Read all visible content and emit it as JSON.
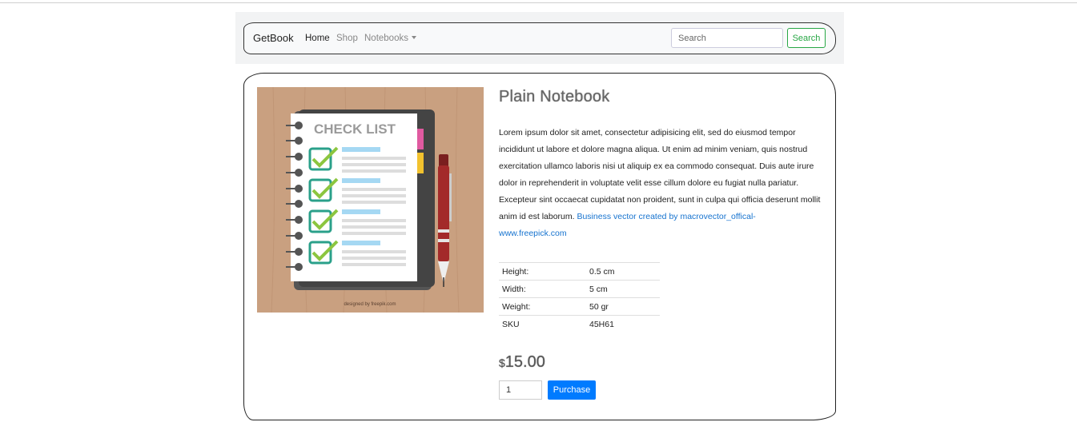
{
  "navbar": {
    "brand": "GetBook",
    "links": [
      {
        "label": "Home"
      },
      {
        "label": "Shop"
      },
      {
        "label": "Notebooks"
      }
    ],
    "search_placeholder": "Search",
    "search_button": "Search"
  },
  "product": {
    "image": {
      "heading": "CHECK LIST",
      "credit": "designed by freepik.com"
    },
    "title": "Plain Notebook",
    "description": "Lorem ipsum dolor sit amet, consectetur adipisicing elit, sed do eiusmod tempor incididunt ut labore et dolore magna aliqua. Ut enim ad minim veniam, quis nostrud exercitation ullamco laboris nisi ut aliquip ex ea commodo consequat. Duis aute irure dolor in reprehenderit in voluptate velit esse cillum dolore eu fugiat nulla pariatur. Excepteur sint occaecat cupidatat non proident, sunt in culpa qui officia deserunt mollit anim id est laborum.",
    "credit_link": "Business vector created by macrovector_offical-www.freepick.com",
    "specs": [
      {
        "label": "Height:",
        "value": "0.5 cm"
      },
      {
        "label": "Width:",
        "value": "5 cm"
      },
      {
        "label": "Weight:",
        "value": "50 gr"
      },
      {
        "label": "SKU",
        "value": "45H61"
      }
    ],
    "price_currency": "$",
    "price_amount": "15.00",
    "quantity": "1",
    "purchase_label": "Purchase"
  },
  "colors": {
    "accent_blue": "#007bff",
    "search_green": "#28a745",
    "link_blue": "#1673cf"
  }
}
